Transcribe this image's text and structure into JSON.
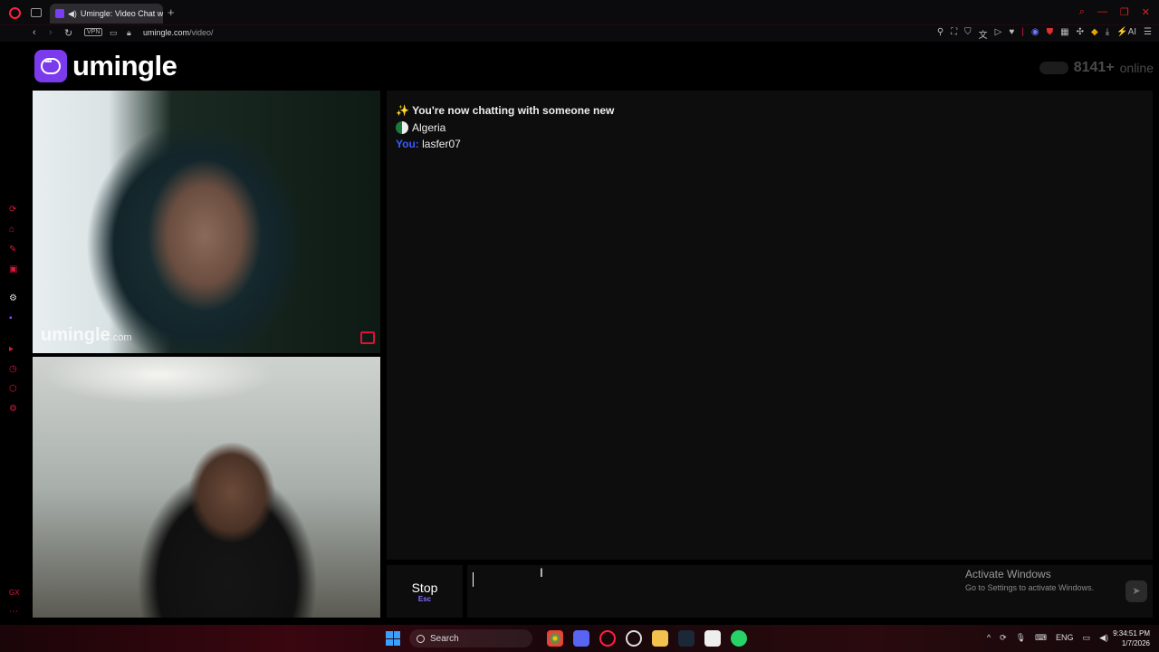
{
  "browser": {
    "tab_title": "Umingle: Video Chat w",
    "url_host": "umingle.com",
    "url_path": "/video/",
    "vpn_label": "VPN",
    "ai_label": "AI"
  },
  "header": {
    "logo_text": "umingle",
    "online_count": "8141+",
    "online_label": "online"
  },
  "stranger_video": {
    "watermark": "umingle",
    "watermark_suffix": ".com"
  },
  "chat": {
    "intro": "You're now chatting with someone new",
    "country": "Algeria",
    "messages": [
      {
        "sender": "You:",
        "text": "lasfer07"
      }
    ]
  },
  "controls": {
    "stop_label": "Stop",
    "stop_key": "Esc",
    "message_value": "",
    "send_icon": "send-icon"
  },
  "windows_watermark": {
    "title": "Activate Windows",
    "subtitle": "Go to Settings to activate Windows."
  },
  "taskbar": {
    "search_label": "Search",
    "language": "ENG",
    "time": "9:34:51 PM",
    "date": "1/7/2026"
  },
  "colors": {
    "brand": "#7c3aed",
    "accent_red": "#d81a3c",
    "you_label": "#3b5cff"
  }
}
